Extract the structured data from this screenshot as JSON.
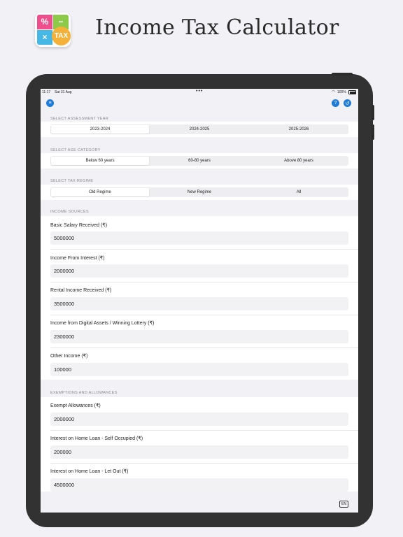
{
  "header": {
    "title": "Income Tax Calculator",
    "logo_badge": "TAX"
  },
  "statusbar": {
    "time": "11:17",
    "date": "Sat 31 Aug",
    "battery": "100%"
  },
  "nav": {
    "left_icon": "menu-icon",
    "right_icons": [
      "help-icon",
      "history-icon"
    ]
  },
  "assessment_year": {
    "label": "SELECT ASSESSMENT YEAR",
    "options": [
      "2023-2024",
      "2024-2025",
      "2025-2026"
    ],
    "selected": "2023-2024"
  },
  "age_category": {
    "label": "SELECT AGE CATEGORY",
    "options": [
      "Below 60 years",
      "60-80 years",
      "Above 80 years"
    ],
    "selected": "Below 60 years"
  },
  "tax_regime": {
    "label": "SELECT TAX REGIME",
    "options": [
      "Old Regime",
      "New Regime",
      "All"
    ],
    "selected": "Old Regime"
  },
  "income_sources": {
    "label": "INCOME SOURCES",
    "fields": [
      {
        "label": "Basic Salary Received (₹)",
        "value": "5000000"
      },
      {
        "label": "Income From Interest (₹)",
        "value": "2000000"
      },
      {
        "label": "Rental Income Received (₹)",
        "value": "3500000"
      },
      {
        "label": "Income from Digital Assets / Winning Lottery (₹)",
        "value": "2300000"
      },
      {
        "label": "Other Income (₹)",
        "value": "100000"
      }
    ]
  },
  "exemptions": {
    "label": "EXEMPTIONS AND ALLOWANCES",
    "fields": [
      {
        "label": "Exempt Allowances (₹)",
        "value": "2000000"
      },
      {
        "label": "Interest on Home Loan - Self Occupied (₹)",
        "value": "200000"
      },
      {
        "label": "Interest on Home Loan - Let Out (₹)",
        "value": "4500000"
      }
    ]
  },
  "language_button": "EN"
}
